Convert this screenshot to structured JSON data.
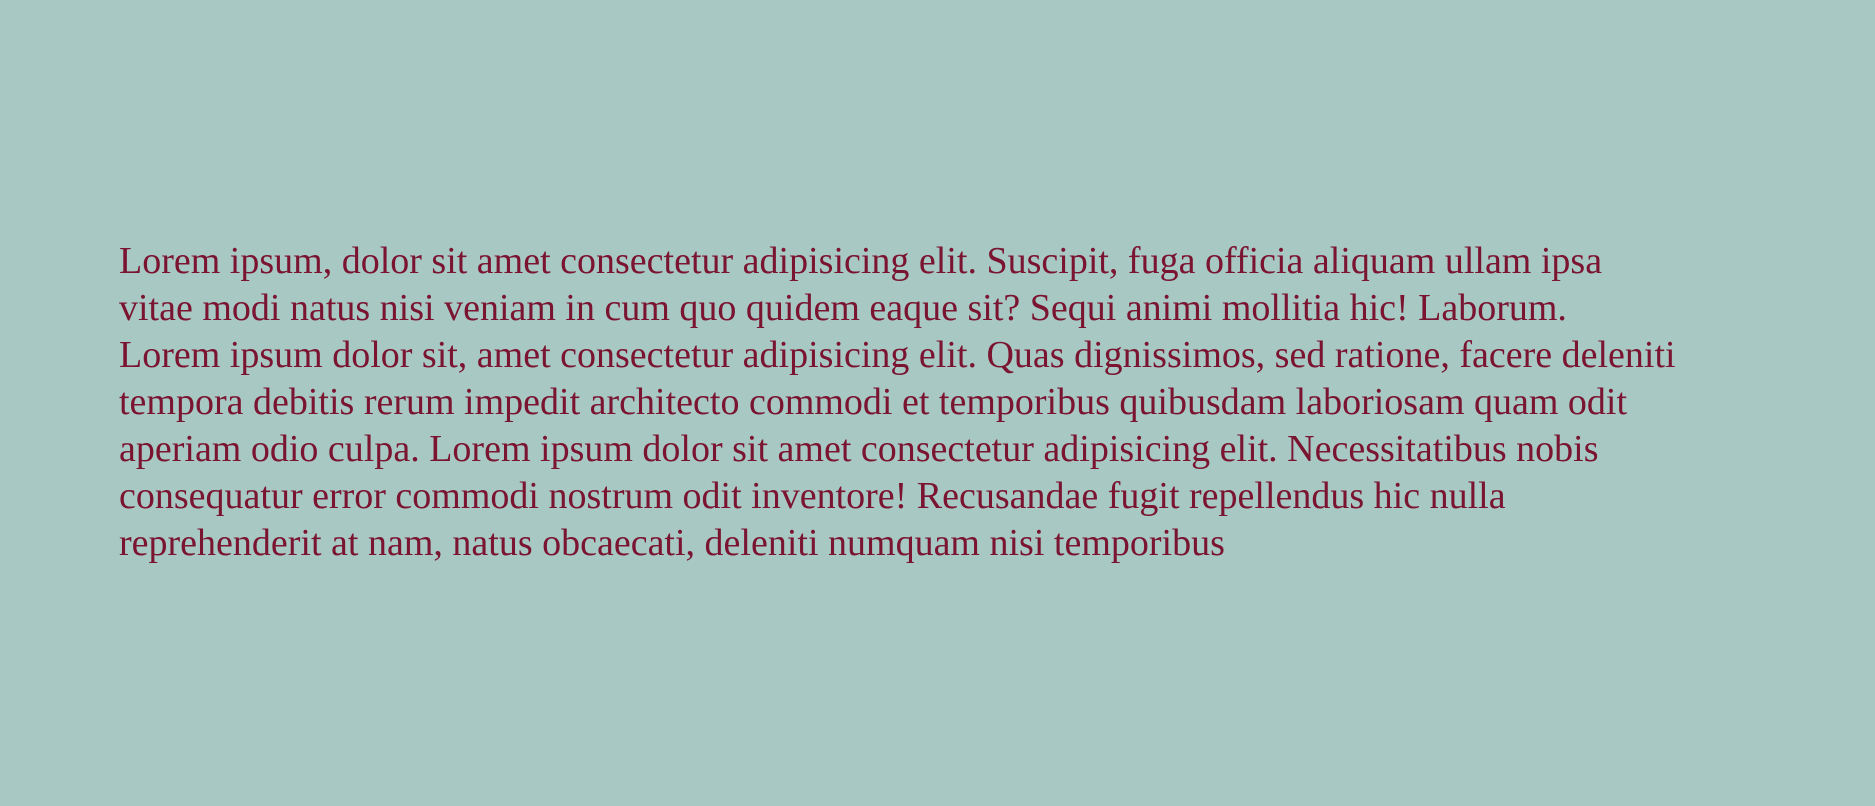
{
  "content": {
    "text_color": "#7a1431",
    "background_color": "#a8c9c3",
    "lines": [
      "Lorem ipsum, dolor sit amet consectetur adipisicing elit. Suscipit, fuga officia aliquam ullam ipsa",
      "vitae modi natus nisi veniam in cum quo quidem eaque sit? Sequi animi mollitia hic! Laborum.",
      "Lorem ipsum dolor sit, amet consectetur adipisicing elit. Quas dignissimos, sed ratione, facere deleniti",
      "tempora debitis rerum impedit architecto commodi et temporibus quibusdam laboriosam quam odit",
      "aperiam odio culpa. Lorem ipsum dolor sit amet consectetur adipisicing elit. Necessitatibus nobis",
      "consequatur error commodi nostrum odit inventore! Recusandae fugit repellendus hic nulla",
      "reprehenderit at nam, natus obcaecati, deleniti numquam nisi temporibus"
    ]
  }
}
